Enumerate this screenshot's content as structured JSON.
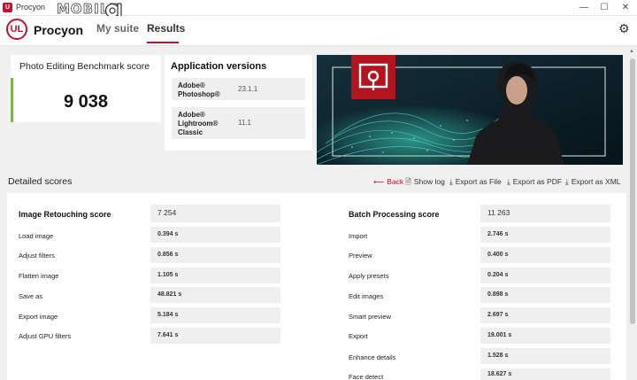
{
  "window": {
    "title": "Procyon",
    "watermark": "MOBILE",
    "controls": [
      "—",
      "☐",
      "✕"
    ]
  },
  "header": {
    "logo_text": "UL",
    "brand": "Procyon",
    "tabs": [
      {
        "label": "My suite",
        "active": false
      },
      {
        "label": "Results",
        "active": true
      }
    ]
  },
  "summary": {
    "title": "Photo Editing Benchmark score",
    "score": "9 038",
    "accent": "#7ab648"
  },
  "versions": {
    "heading": "Application versions",
    "items": [
      {
        "name": "Adobe® Photoshop®",
        "version": "23.1.1"
      },
      {
        "name": "Adobe® Lightroom® Classic",
        "version": "11.1"
      }
    ]
  },
  "detailed": {
    "title": "Detailed scores",
    "actions": [
      {
        "label": "Back",
        "icon": "arrow-left-icon"
      },
      {
        "label": "Show log",
        "icon": "document-icon"
      },
      {
        "label": "Export as File",
        "icon": "download-icon"
      },
      {
        "label": "Export as PDF",
        "icon": "download-icon"
      },
      {
        "label": "Export as XML",
        "icon": "download-icon"
      }
    ],
    "retouching": {
      "title": "Image Retouching score",
      "score": "7 254",
      "rows": [
        {
          "name": "Load image",
          "value": "0.394 s"
        },
        {
          "name": "Adjust filters",
          "value": "0.856 s"
        },
        {
          "name": "Flatten image",
          "value": "1.105 s"
        },
        {
          "name": "Save as",
          "value": "48.821 s"
        },
        {
          "name": "Export image",
          "value": "5.184 s"
        },
        {
          "name": "Adjust GPU filters",
          "value": "7.641 s"
        }
      ]
    },
    "batch": {
      "title": "Batch Processing score",
      "score": "11 263",
      "rows": [
        {
          "name": "Import",
          "value": "2.746 s"
        },
        {
          "name": "Preview",
          "value": "0.400 s"
        },
        {
          "name": "Apply presets",
          "value": "0.204 s"
        },
        {
          "name": "Edit images",
          "value": "0.898 s"
        },
        {
          "name": "Smart preview",
          "value": "2.697 s"
        },
        {
          "name": "Export",
          "value": "19.001 s"
        },
        {
          "name": "Enhance details",
          "value": "1.528 s"
        },
        {
          "name": "Face detect",
          "value": "18.627 s"
        }
      ]
    }
  },
  "colors": {
    "brand_red": "#c8102e",
    "accent_green": "#7ab648",
    "background": "#f0f0f0"
  }
}
